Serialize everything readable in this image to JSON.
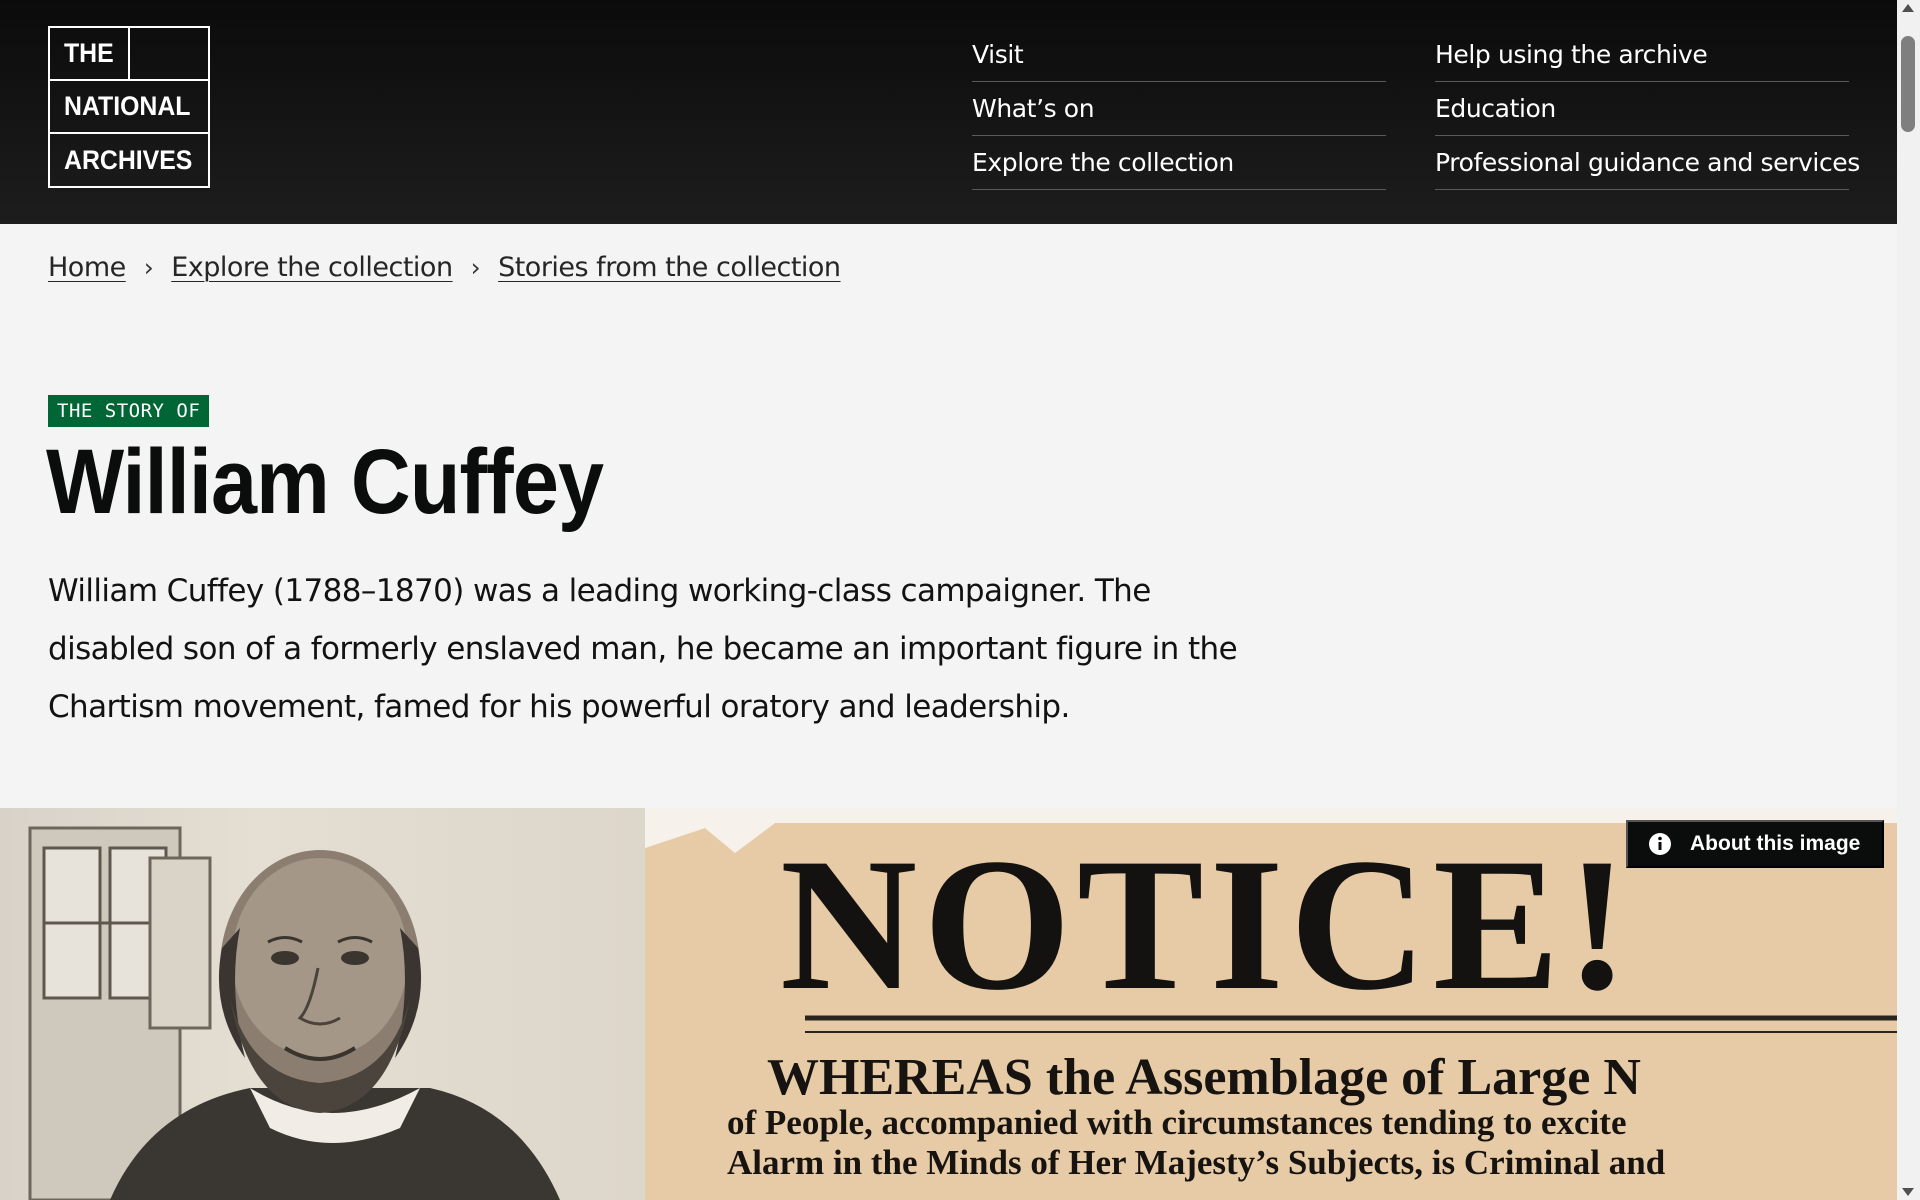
{
  "logo": {
    "line1": "THE",
    "line2": "NATIONAL",
    "line3": "ARCHIVES"
  },
  "nav": {
    "col1": [
      "Visit",
      "What’s on",
      "Explore the collection"
    ],
    "col2": [
      "Help using the archive",
      "Education",
      "Professional guidance and services"
    ]
  },
  "breadcrumb": [
    "Home",
    "Explore the collection",
    "Stories from the collection"
  ],
  "breadcrumb_separator": "›",
  "hero": {
    "eyebrow": "THE STORY OF",
    "title": "William Cuffey",
    "intro": "William Cuffey (1788–1870) was a leading working-class campaigner. The disabled son of a formerly enslaved man, he became an important figure in the Chartism movement, famed for his powerful oratory and leadership."
  },
  "image": {
    "about_label": "About this image",
    "notice_heading": "NOTICE!",
    "notice_lines": [
      "WHEREAS the Assemblage of Large N",
      "of People, accompanied with circumstances tending to excite",
      "Alarm in the Minds of Her Majesty’s Subjects, is Criminal and"
    ]
  },
  "colors": {
    "header_bg": "#0b0b0b",
    "page_bg": "#f4f4f4",
    "eyebrow_bg": "#006635",
    "text": "#0b0c0c"
  },
  "icons": [
    "info-icon",
    "scroll-up-arrow-icon",
    "scroll-down-arrow-icon"
  ]
}
